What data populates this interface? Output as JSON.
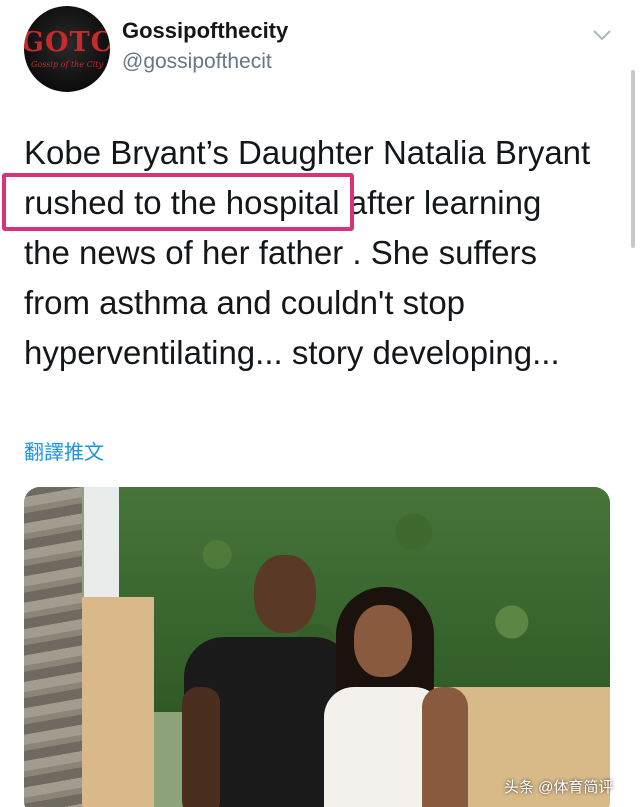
{
  "tweet": {
    "avatar_text": "GOTC",
    "avatar_script": "Gossip of the City",
    "display_name": "Gossipofthecity",
    "handle": "@gossipofthecit",
    "menu_icon": "chevron-down-icon",
    "text_lines": [
      "Kobe Bryant’s Daughter Natalia Bryant",
      "rushed to the hospital",
      " after learning",
      "the news of her father . She suffers",
      "from asthma and couldn't stop",
      "hyperventilating... story developing..."
    ],
    "highlight_color": "#d8337a",
    "translate_label": "翻譯推文",
    "link_color": "#1b95e0",
    "photo_icon": "photo-image"
  },
  "watermark": "头条 @体育简评"
}
